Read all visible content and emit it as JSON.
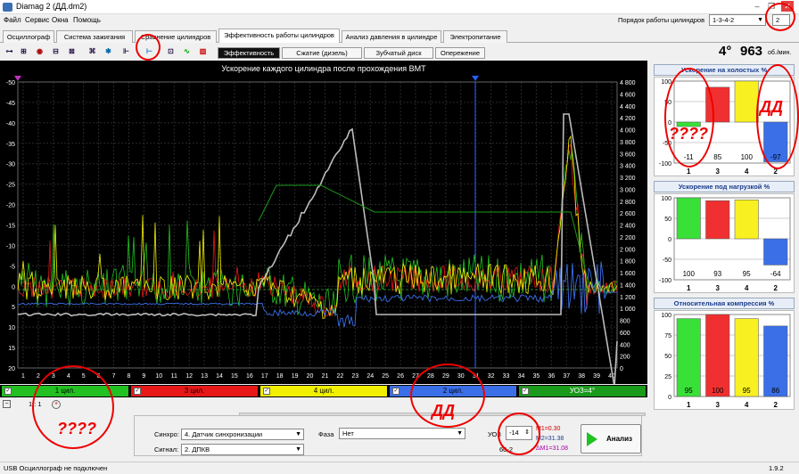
{
  "window": {
    "title": "Diamag 2 (ДД.dm2)",
    "min": "–",
    "max": "❐",
    "close": "✕"
  },
  "menu": [
    "Файл",
    "Сервис",
    "Окна",
    "Помощь"
  ],
  "firing_order": {
    "label": "Порядок работы цилиндров",
    "value": "1-3-4-2",
    "extra": "2"
  },
  "tabs": [
    "Осциллограф",
    "Система зажигания",
    "Сравнение цилиндров",
    "Эффективность работы цилиндров",
    "Анализ давления в цилиндре",
    "Электропитание"
  ],
  "subtabs": [
    "Эффективность",
    "Сжатие (дизель)",
    "Зубчатый диск",
    "Опережение"
  ],
  "rpm": {
    "angle": "4°",
    "value": "963",
    "unit": "об./мин."
  },
  "chart": {
    "title": "Ускорение каждого цилиндра после прохождения ВМТ"
  },
  "chart_data": {
    "type": "line",
    "left_ticks": [
      "-50",
      "-45",
      "-40",
      "-35",
      "-30",
      "-25",
      "-20",
      "-15",
      "-10",
      "-5",
      "0",
      "5",
      "10",
      "15",
      "20"
    ],
    "right_ticks": [
      "4 800",
      "4 600",
      "4 400",
      "4 200",
      "4 000",
      "3 800",
      "3 600",
      "3 400",
      "3 200",
      "3 000",
      "2 800",
      "2 600",
      "2 400",
      "2 200",
      "2 000",
      "1 800",
      "1 600",
      "1 400",
      "1 200",
      "1 000",
      "800",
      "600",
      "400",
      "200",
      "0"
    ],
    "x_ticks": [
      "1",
      "2",
      "3",
      "4",
      "5",
      "6",
      "7",
      "8",
      "9",
      "10",
      "11",
      "12",
      "13",
      "14",
      "15",
      "16",
      "17",
      "18",
      "19",
      "20",
      "21",
      "22",
      "23",
      "24",
      "25",
      "26",
      "27",
      "28",
      "29",
      "30",
      "31",
      "32",
      "33",
      "34",
      "35",
      "36",
      "37",
      "38",
      "39",
      "40"
    ],
    "series": [
      {
        "name": "1 цил.",
        "color": "#22c020"
      },
      {
        "name": "3 цил.",
        "color": "#e81818"
      },
      {
        "name": "4 цил.",
        "color": "#f0f000"
      },
      {
        "name": "2 цил.",
        "color": "#3a6fe8"
      },
      {
        "name": "УОЗ=4°",
        "color": "#1a9a1a"
      }
    ]
  },
  "scroll": {
    "left": "1 : 1"
  },
  "controls": {
    "sync_label": "Синхро:",
    "sync_value": "4. Датчик синхронизации",
    "signal_label": "Сигнал:",
    "signal_value": "2. ДПКВ",
    "phase_label": "Фаза",
    "phase_value": "Нет",
    "uoz_label": "УОЗ",
    "uoz_value": "-14",
    "teeth": "60-2",
    "m1": "M1=0.30",
    "m2": "M2=31.38",
    "dm": "ΔM1=31.08",
    "analyze": "Анализ"
  },
  "status": {
    "left": "USB Осциллограф не подключен",
    "right": "1.9.2"
  },
  "panels": [
    {
      "title": "Ускорение на холостых %",
      "ticks": [
        "100",
        "50",
        "0",
        "-50",
        "-100"
      ],
      "cyl": [
        "1",
        "3",
        "4",
        "2"
      ],
      "values": [
        -11,
        85,
        100,
        -97
      ],
      "labels": [
        "-11",
        "85",
        "100",
        "-97"
      ],
      "colors": [
        "#38e038",
        "#f03030",
        "#f8f020",
        "#3a6fe8"
      ]
    },
    {
      "title": "Ускорение под нагрузкой %",
      "ticks": [
        "100",
        "50",
        "0",
        "-50",
        "-100"
      ],
      "cyl": [
        "1",
        "3",
        "4",
        "2"
      ],
      "values": [
        100,
        93,
        95,
        -64
      ],
      "labels": [
        "100",
        "93",
        "95",
        "-64"
      ],
      "colors": [
        "#38e038",
        "#f03030",
        "#f8f020",
        "#3a6fe8"
      ]
    },
    {
      "title": "Относительная компрессия %",
      "ticks": [
        "100",
        "75",
        "50",
        "25",
        "0"
      ],
      "cyl": [
        "1",
        "3",
        "4",
        "2"
      ],
      "values": [
        95,
        100,
        95,
        86
      ],
      "labels": [
        "95",
        "100",
        "95",
        "86"
      ],
      "colors": [
        "#38e038",
        "#f03030",
        "#f8f020",
        "#3a6fe8"
      ]
    }
  ],
  "annotations": {
    "q1": "????",
    "dd1": "ДД",
    "q2": "????",
    "dd2": "ДД"
  }
}
